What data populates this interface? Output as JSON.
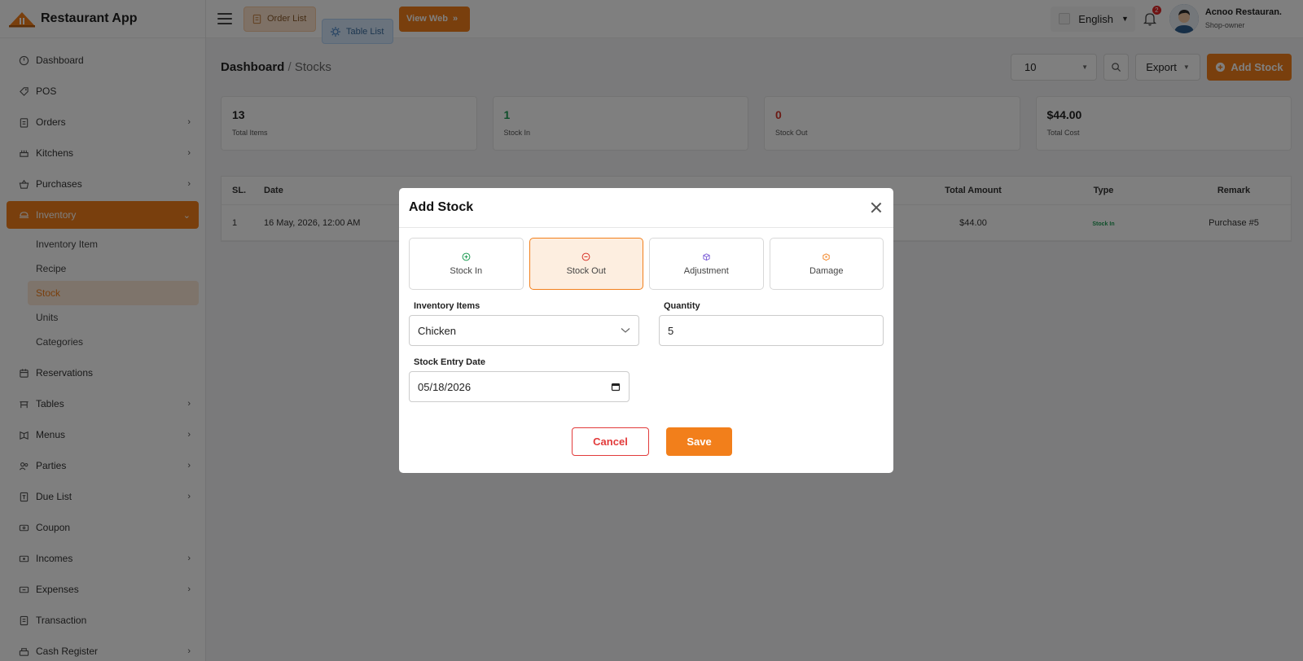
{
  "brand": {
    "name": "Restaurant App"
  },
  "header": {
    "order_list": "Order List",
    "table_list": "Table List",
    "view_web": "View Web",
    "language": "English",
    "notif_count": "2",
    "user_name": "Acnoo Restauran.",
    "user_role": "Shop-owner"
  },
  "sidebar": {
    "items": [
      {
        "label": "Dashboard",
        "icon": "dashboard-icon"
      },
      {
        "label": "POS",
        "icon": "tag-icon"
      },
      {
        "label": "Orders",
        "icon": "clipboard-icon"
      },
      {
        "label": "Kitchens",
        "icon": "kitchen-icon"
      },
      {
        "label": "Purchases",
        "icon": "basket-icon"
      },
      {
        "label": "Inventory",
        "icon": "inventory-icon"
      },
      {
        "label": "Reservations",
        "icon": "calendar-icon"
      },
      {
        "label": "Tables",
        "icon": "table-icon"
      },
      {
        "label": "Menus",
        "icon": "menu-icon"
      },
      {
        "label": "Parties",
        "icon": "users-icon"
      },
      {
        "label": "Due List",
        "icon": "due-icon"
      },
      {
        "label": "Coupon",
        "icon": "coupon-icon"
      },
      {
        "label": "Incomes",
        "icon": "income-icon"
      },
      {
        "label": "Expenses",
        "icon": "expense-icon"
      },
      {
        "label": "Transaction",
        "icon": "transaction-icon"
      },
      {
        "label": "Cash Register",
        "icon": "cash-register-icon"
      }
    ],
    "inventory_sub": [
      "Inventory Item",
      "Recipe",
      "Stock",
      "Units",
      "Categories"
    ]
  },
  "breadcrumb": {
    "root": "Dashboard",
    "sep": " / ",
    "current": "Stocks"
  },
  "toolbar": {
    "per_page": "10",
    "export": "Export",
    "add_stock": "Add Stock"
  },
  "stats": [
    {
      "value": "13",
      "label": "Total Items"
    },
    {
      "value": "1",
      "label": "Stock In"
    },
    {
      "value": "0",
      "label": "Stock Out"
    },
    {
      "value": "$44.00",
      "label": "Total Cost"
    }
  ],
  "table": {
    "headers": {
      "sl": "SL.",
      "date": "Date",
      "amount": "Total Amount",
      "type": "Type",
      "remark": "Remark"
    },
    "rows": [
      {
        "sl": "1",
        "date": "16 May, 2026, 12:00 AM",
        "amount": "$44.00",
        "type": "Stock In",
        "remark": "Purchase #5"
      }
    ]
  },
  "modal": {
    "title": "Add Stock",
    "types": [
      "Stock In",
      "Stock Out",
      "Adjustment",
      "Damage"
    ],
    "selected_type": "Stock Out",
    "inventory_label": "Inventory Items",
    "inventory_value": "Chicken",
    "quantity_label": "Quantity",
    "quantity_value": "5",
    "date_label": "Stock Entry Date",
    "date_value": "05/18/2026",
    "cancel": "Cancel",
    "save": "Save"
  },
  "colors": {
    "accent": "#f27f1b",
    "green": "#1f9d55",
    "red": "#d9362b",
    "purple": "#7b5cd6"
  }
}
